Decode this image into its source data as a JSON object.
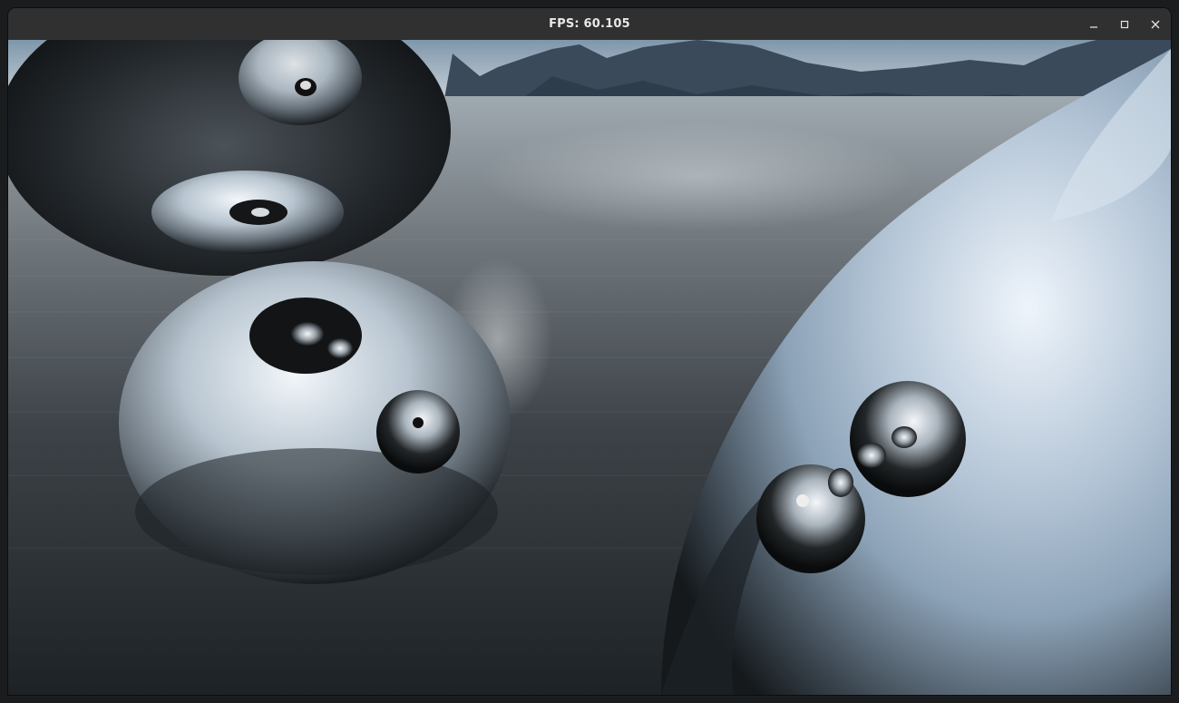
{
  "window": {
    "title": "FPS: 60.105",
    "controls": [
      {
        "name": "minimize-button",
        "icon": "minimize-icon"
      },
      {
        "name": "maximize-button",
        "icon": "maximize-icon"
      },
      {
        "name": "close-button",
        "icon": "close-icon"
      }
    ]
  },
  "scene": {
    "description_icon": "render-canvas",
    "colors": {
      "sky_top": "#7f97ab",
      "sky_horizon": "#cbd3d8",
      "mountain": "#3a4a5a",
      "water_far": "#aab4bb",
      "water_near": "#23282d",
      "chrome_light": "#e6eef6",
      "chrome_dark": "#121518"
    }
  }
}
